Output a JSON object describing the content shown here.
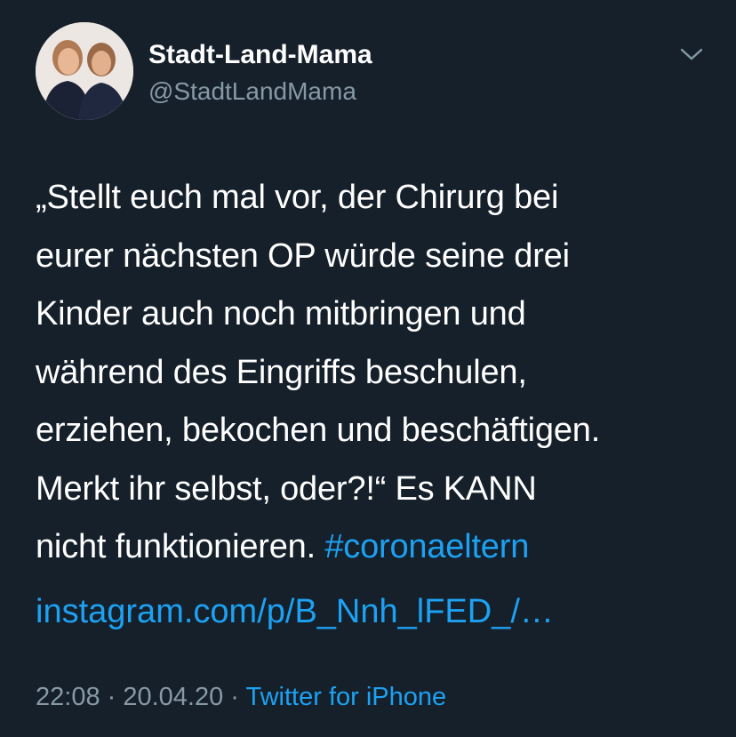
{
  "user": {
    "display_name": "Stadt-Land-Mama",
    "handle": "@StadtLandMama"
  },
  "tweet": {
    "lines": [
      "„Stellt euch mal vor, der Chirurg bei",
      "eurer nächsten OP würde seine drei",
      "Kinder auch noch mitbringen und",
      "während des Eingriffs beschulen,",
      "erziehen, bekochen und beschäftigen.",
      "Merkt ihr selbst, oder?!“ Es KANN",
      "nicht funktionieren. "
    ],
    "hashtag": "#coronaeltern",
    "link": "instagram.com/p/B_Nnh_lFED_/…"
  },
  "meta": {
    "time": "22:08",
    "separator1": " · ",
    "date": "20.04.20",
    "separator2": " · ",
    "source": "Twitter for iPhone"
  },
  "icons": {
    "more": "chevron-down-icon"
  },
  "colors": {
    "background": "#15202b",
    "text": "#ffffff",
    "secondary": "#8899a6",
    "accent": "#1da1f2"
  }
}
